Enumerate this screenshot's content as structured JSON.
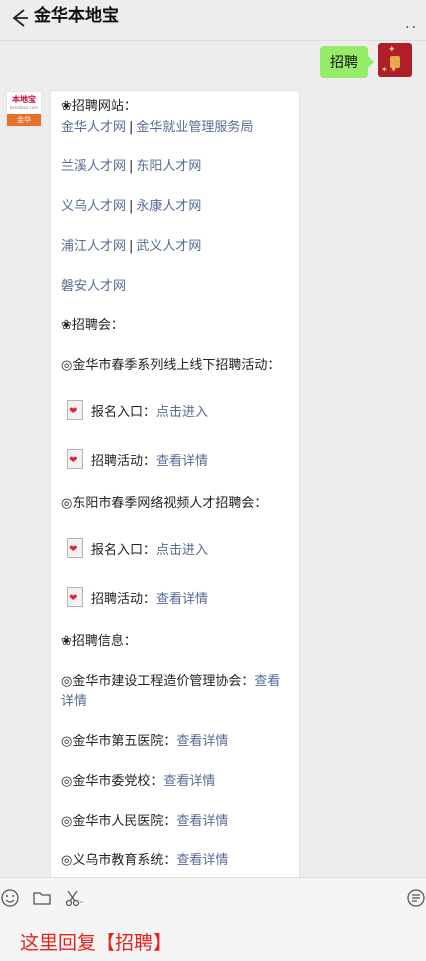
{
  "header": {
    "title": "金华本地宝",
    "more": ".."
  },
  "outgoing": {
    "text": "招聘"
  },
  "avatar": {
    "brand": "本地宝",
    "sub": "bendibao.com",
    "city": "金华"
  },
  "content": {
    "sec1": "❀招聘网站：",
    "l1a": "金华人才网",
    "l1b": "金华就业管理服务局",
    "l2a": "兰溪人才网",
    "l2b": "东阳人才网",
    "l3a": "义乌人才网",
    "l3b": "永康人才网",
    "l4a": "浦江人才网",
    "l4b": "武义人才网",
    "l5": "磐安人才网",
    "sec2": "❀招聘会：",
    "ev1": "◎金华市春季系列线上线下招聘活动：",
    "sign_label": "报名入口：",
    "sign_link": "点击进入",
    "act_label": "招聘活动：",
    "act_link": "查看详情",
    "ev2": "◎东阳市春季网络视频人才招聘会：",
    "sec3": "❀招聘信息：",
    "i1": "◎金华市建设工程造价管理协会：",
    "i1_link_a": "查看",
    "i1_link_b": "详情",
    "i2": "◎金华市第五医院：",
    "i3": "◎金华市委党校：",
    "i4": "◎金华市人民医院：",
    "i5": "◎义乌市教育系统：",
    "detail_link": "查看详情"
  },
  "footer": {
    "reply": "这里回复【招聘】"
  }
}
